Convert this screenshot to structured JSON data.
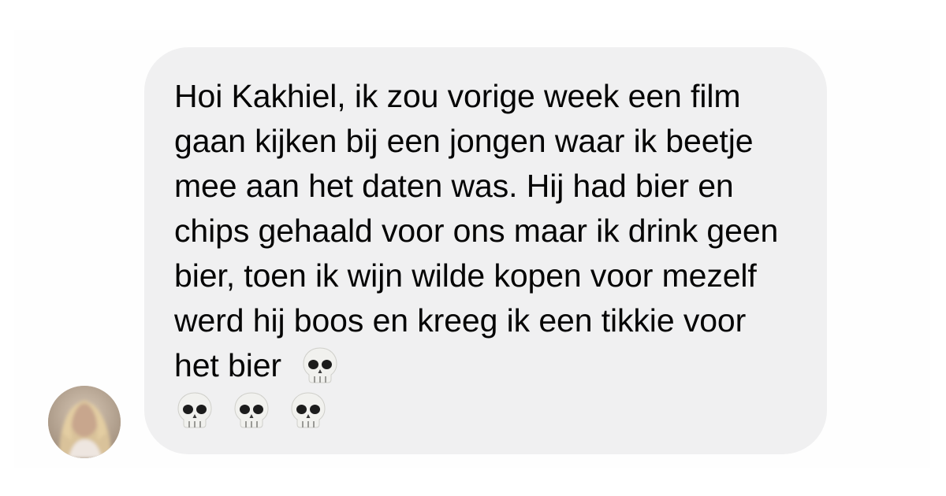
{
  "conversation": {
    "sender_avatar": {
      "description": "blurred-face-profile-photo",
      "icon": "avatar-photo"
    },
    "message": {
      "text": "Hoi Kakhiel, ik zou vorige week een film gaan kijken bij een jongen waar ik beetje mee aan het daten was. Hij had bier en chips gehaald voor ons maar ik drink geen bier, toen ik wijn wilde kopen voor mezelf werd hij boos en kreeg ik een tikkie voor het bier",
      "emojis": [
        "skull-emoji",
        "skull-emoji",
        "skull-emoji",
        "skull-emoji"
      ]
    }
  },
  "colors": {
    "bubble_background": "#f0f0f1",
    "text": "#050505",
    "page_background": "#ffffff"
  }
}
